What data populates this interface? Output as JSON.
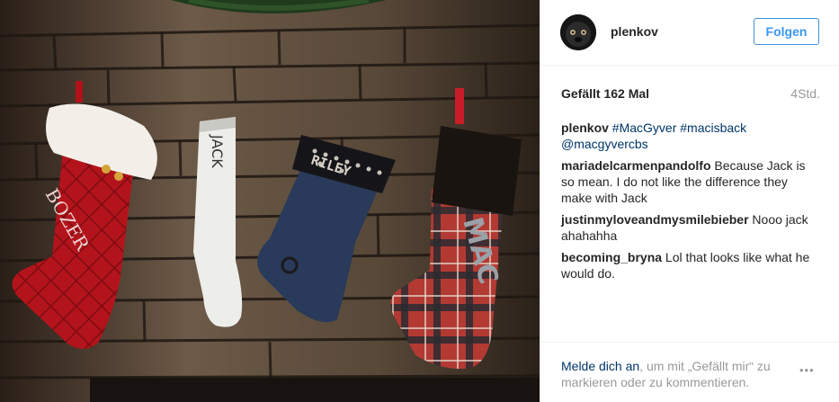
{
  "post": {
    "image_alt": "Four Christmas stockings hanging on a stone fireplace",
    "username": "plenkov",
    "follow_label": "Folgen",
    "likes": "Gefällt 162 Mal",
    "time_ago": "4Std.",
    "caption": {
      "user": "plenkov",
      "tags": [
        "#MacGyver",
        "#macisback",
        "@macgyvercbs"
      ]
    },
    "comments": [
      {
        "user": "mariadelcarmenpandolfo",
        "text": "Because Jack is so mean. I do not like the difference they make with Jack"
      },
      {
        "user": "justinmyloveandmysmilebieber",
        "text": "Nooo jack ahahahha"
      },
      {
        "user": "becoming_bryna",
        "text": "Lol that looks like what he would do."
      }
    ],
    "footer": {
      "login_link": "Melde dich an",
      "login_rest": ", um mit „Gefällt mir“ zu markieren oder zu kommentieren.",
      "more_icon": "•••"
    },
    "stockings": [
      "BOZER",
      "JACK",
      "RILEY",
      "MAC"
    ]
  }
}
